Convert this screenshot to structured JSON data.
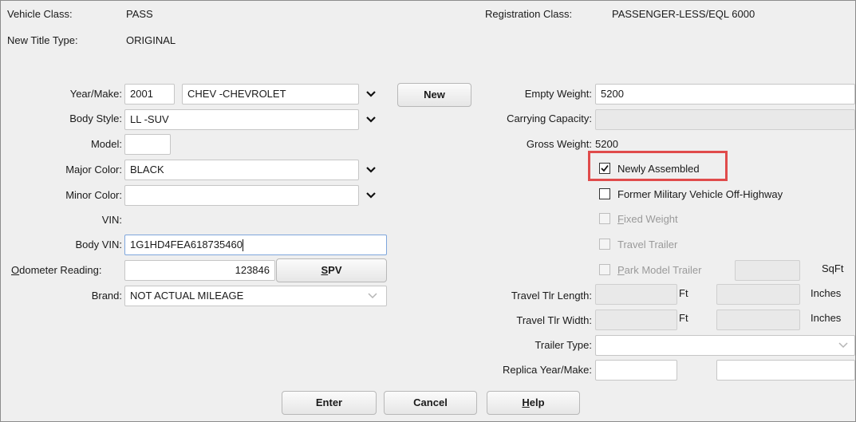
{
  "header": {
    "vehicle_class_label": "Vehicle Class:",
    "vehicle_class_value": "PASS",
    "registration_class_label": "Registration Class:",
    "registration_class_value": "PASSENGER-LESS/EQL 6000",
    "new_title_type_label": "New Title Type:",
    "new_title_type_value": "ORIGINAL"
  },
  "left": {
    "year_make_label": "Year/Make:",
    "year_value": "2001",
    "make_value": "CHEV -CHEVROLET",
    "new_button": "New",
    "body_style_label": "Body Style:",
    "body_style_value": "LL -SUV",
    "model_label": "Model:",
    "model_value": "",
    "major_color_label": "Major Color:",
    "major_color_value": "BLACK",
    "minor_color_label": "Minor Color:",
    "minor_color_value": "",
    "vin_label": "VIN:",
    "body_vin_label": "Body VIN:",
    "body_vin_value": "1G1HD4FEA618735460",
    "odometer_label_first": "O",
    "odometer_label_rest": "dometer Reading:",
    "odometer_value": "123846",
    "spv_button_first": "S",
    "spv_button_rest": "PV",
    "brand_label": "Brand:",
    "brand_value": "NOT ACTUAL MILEAGE"
  },
  "right": {
    "empty_weight_label": "Empty Weight:",
    "empty_weight_value": "5200",
    "carrying_capacity_label": "Carrying Capacity:",
    "carrying_capacity_value": "",
    "gross_weight_label": "Gross Weight:",
    "gross_weight_value": "5200",
    "newly_assembled_label": "Newly Assembled",
    "newly_assembled_checked": true,
    "former_military_label": "Former Military Vehicle Off-Highway",
    "fixed_weight_first": "F",
    "fixed_weight_rest": "ixed Weight",
    "travel_trailer_label": "Travel Trailer",
    "park_model_first": "P",
    "park_model_rest": "ark Model Trailer",
    "sqft_label": "SqFt",
    "travel_tlr_length_label": "Travel Tlr Length:",
    "travel_tlr_width_label": "Travel Tlr Width:",
    "ft_label": "Ft",
    "inches_label": "Inches",
    "trailer_type_label": "Trailer Type:",
    "trailer_type_value": "",
    "replica_label": "Replica Year/Make:"
  },
  "footer": {
    "enter_button": "Enter",
    "cancel_button": "Cancel",
    "help_button_first": "H",
    "help_button_rest": "elp"
  },
  "colors": {
    "panel_bg": "#efefef",
    "highlight_border": "#e04b4b",
    "focus_border": "#7ea6dc"
  }
}
